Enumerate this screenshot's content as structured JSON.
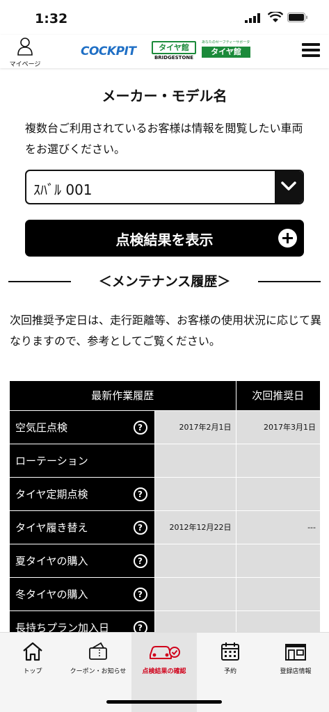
{
  "status_bar": {
    "time": "1:32"
  },
  "header": {
    "mypage_label": "マイページ",
    "logo_cockpit": "COCKPIT",
    "logo_taiyakan": "タイヤ館",
    "logo_bridgestone": "BRIDGESTONE",
    "logo_safety_tagline": "あなたのセーフティーサポーター",
    "logo_safety_name": "タイヤ館"
  },
  "main": {
    "title": "メーカー・モデル名",
    "description": "複数台ご利用されているお客様は情報を閲覧したい車両をお選びください。",
    "vehicle_select": {
      "value": "ｽﾊﾞﾙ 001"
    },
    "show_button_label": "点検結果を表示",
    "maintenance_title": "＜メンテナンス履歴＞",
    "note": "次回推奨予定日は、走行距離等、お客様の使用状況に応じて異なりますので、参考としてご覧ください。"
  },
  "table": {
    "headers": [
      "最新作業履歴",
      "次回推奨日"
    ],
    "rows": [
      {
        "name": "空気圧点検",
        "help": true,
        "latest": "2017年2月1日",
        "next": "2017年3月1日"
      },
      {
        "name": "ローテーション",
        "help": false,
        "latest": "",
        "next": ""
      },
      {
        "name": "タイヤ定期点検",
        "help": true,
        "latest": "",
        "next": ""
      },
      {
        "name": "タイヤ履き替え",
        "help": true,
        "latest": "2012年12月22日",
        "next": "---"
      },
      {
        "name": "夏タイヤの購入",
        "help": true,
        "latest": "",
        "next": ""
      },
      {
        "name": "冬タイヤの購入",
        "help": true,
        "latest": "",
        "next": ""
      },
      {
        "name": "長持ちプラン加入日",
        "help": true,
        "latest": "",
        "next": ""
      }
    ],
    "help_symbol": "?"
  },
  "tabbar": {
    "items": [
      {
        "label": "トップ",
        "icon": "home-icon"
      },
      {
        "label": "クーポン・お知らせ",
        "icon": "coupon-icon"
      },
      {
        "label": "点検結果の確認",
        "icon": "car-check-icon",
        "active": true
      },
      {
        "label": "予約",
        "icon": "calendar-icon"
      },
      {
        "label": "登録店情報",
        "icon": "store-icon"
      }
    ]
  },
  "colors": {
    "accent_red": "#d0021b",
    "brand_blue": "#1f6fc5",
    "brand_green": "#1b8a3a"
  }
}
